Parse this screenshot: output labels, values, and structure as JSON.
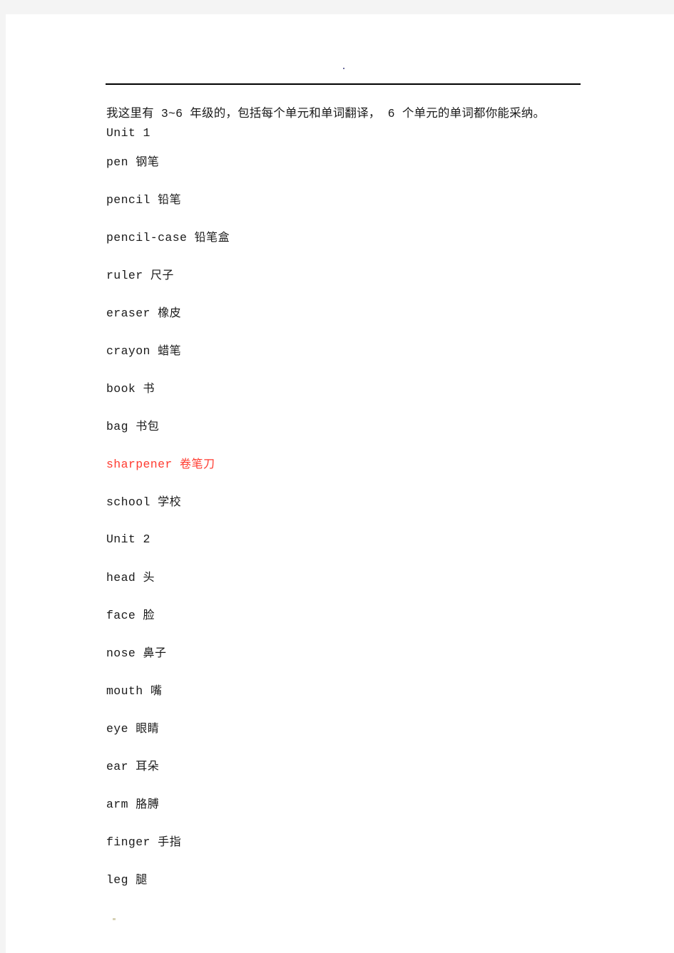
{
  "document": {
    "intro_paragraph": "我这里有 3~6 年级的，包括每个单元和单词翻译， 6 个单元的单词都你能采纳。",
    "accent_color": "#ff3b30",
    "text_color": "#1a1a1a",
    "page_background": "#ffffff",
    "canvas_background": "#f4f4f4"
  },
  "lines": [
    {
      "text": "Unit 1",
      "type": "unit",
      "highlight": false
    },
    {
      "en": "pen",
      "zh": "钢笔",
      "type": "word",
      "highlight": false
    },
    {
      "en": "pencil",
      "zh": "铅笔",
      "type": "word",
      "highlight": false
    },
    {
      "en": "pencil-case",
      "zh": "铅笔盒",
      "type": "word",
      "highlight": false
    },
    {
      "en": "ruler",
      "zh": "尺子",
      "type": "word",
      "highlight": false
    },
    {
      "en": "eraser",
      "zh": "橡皮",
      "type": "word",
      "highlight": false
    },
    {
      "en": "crayon",
      "zh": "蜡笔",
      "type": "word",
      "highlight": false
    },
    {
      "en": "book",
      "zh": "书",
      "type": "word",
      "highlight": false
    },
    {
      "en": "bag",
      "zh": "书包",
      "type": "word",
      "highlight": false
    },
    {
      "en": "sharpener",
      "zh": "卷笔刀",
      "type": "word",
      "highlight": true
    },
    {
      "en": "school",
      "zh": "学校",
      "type": "word",
      "highlight": false
    },
    {
      "text": "Unit 2",
      "type": "unit",
      "highlight": false
    },
    {
      "en": "head",
      "zh": "头",
      "type": "word",
      "highlight": false
    },
    {
      "en": "face",
      "zh": "脸",
      "type": "word",
      "highlight": false
    },
    {
      "en": "nose",
      "zh": "鼻子",
      "type": "word",
      "highlight": false
    },
    {
      "en": "mouth",
      "zh": "嘴",
      "type": "word",
      "highlight": false
    },
    {
      "en": "eye",
      "zh": "眼睛",
      "type": "word",
      "highlight": false
    },
    {
      "en": "ear",
      "zh": "耳朵",
      "type": "word",
      "highlight": false
    },
    {
      "en": "arm",
      "zh": "胳膊",
      "type": "word",
      "highlight": false
    },
    {
      "en": "finger",
      "zh": "手指",
      "type": "word",
      "highlight": false
    },
    {
      "en": "leg",
      "zh": "腿",
      "type": "word",
      "highlight": false
    }
  ]
}
